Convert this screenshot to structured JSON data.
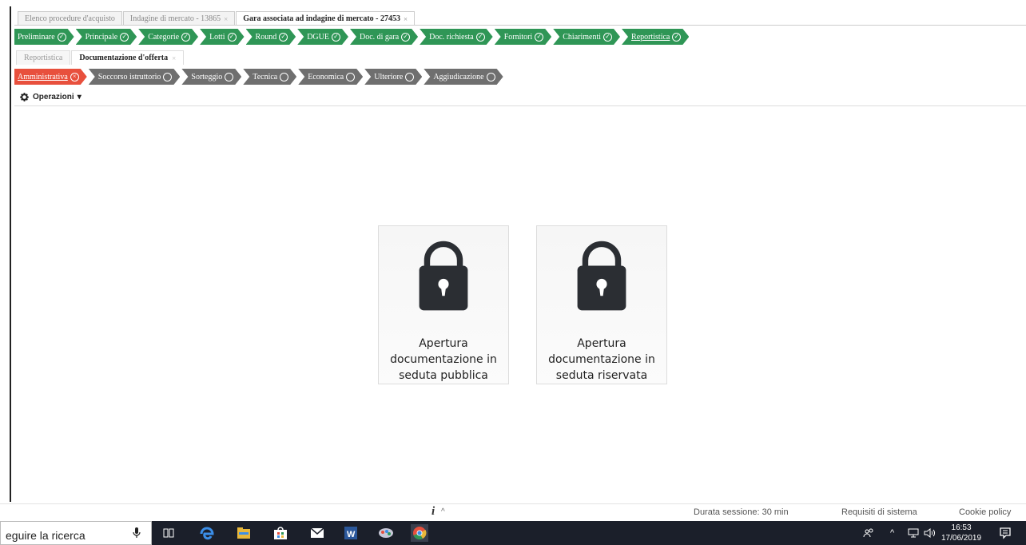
{
  "top_tabs": [
    {
      "label": "Elenco procedure d'acquisto",
      "active": false
    },
    {
      "label": "Indagine di mercato - 13865",
      "active": false,
      "close": "×"
    },
    {
      "label": "Gara associata ad indagine di mercato - 27453",
      "active": true,
      "close": "×"
    }
  ],
  "phases": [
    {
      "label": "Preliminare",
      "status": "done"
    },
    {
      "label": "Principale",
      "status": "done"
    },
    {
      "label": "Categorie",
      "status": "done"
    },
    {
      "label": "Lotti",
      "status": "done"
    },
    {
      "label": "Round",
      "status": "done"
    },
    {
      "label": "DGUE",
      "status": "done"
    },
    {
      "label": "Doc. di gara",
      "status": "done"
    },
    {
      "label": "Doc. richiesta",
      "status": "done"
    },
    {
      "label": "Fornitori",
      "status": "done"
    },
    {
      "label": "Chiarimenti",
      "status": "done"
    },
    {
      "label": "Reportistica",
      "status": "done"
    }
  ],
  "sub_tabs": [
    {
      "label": "Reportistica",
      "active": false
    },
    {
      "label": "Documentazione d'offerta",
      "active": true,
      "close": "×"
    }
  ],
  "offer_steps": [
    {
      "label": "Amministrativa",
      "status": "alert"
    },
    {
      "label": "Soccorso istruttorio",
      "status": "todo"
    },
    {
      "label": "Sorteggio",
      "status": "todo"
    },
    {
      "label": "Tecnica",
      "status": "todo"
    },
    {
      "label": "Economica",
      "status": "todo"
    },
    {
      "label": "Ulteriore",
      "status": "todo"
    },
    {
      "label": "Aggiudicazione",
      "status": "todo"
    }
  ],
  "operations": {
    "label": "Operazioni",
    "icon": "gear-icon"
  },
  "cards": [
    {
      "label": "Apertura documentazione in seduta pubblica",
      "icon": "lock-icon"
    },
    {
      "label": "Apertura documentazione in seduta riservata",
      "icon": "lock-icon"
    }
  ],
  "footer": {
    "info_icon": "i",
    "session": "Durata sessione: 30 min",
    "requirements": "Requisiti di sistema",
    "cookie": "Cookie policy"
  },
  "taskbar": {
    "search_placeholder": "Cerca per eseguire la ricerca",
    "search_visible": "eguire la ricerca",
    "time": "16:53",
    "date": "17/06/2019"
  },
  "colors": {
    "done": "#2f9656",
    "alert": "#e8503d",
    "todo": "#6f6f6f",
    "taskbar": "#1b1f2a"
  }
}
